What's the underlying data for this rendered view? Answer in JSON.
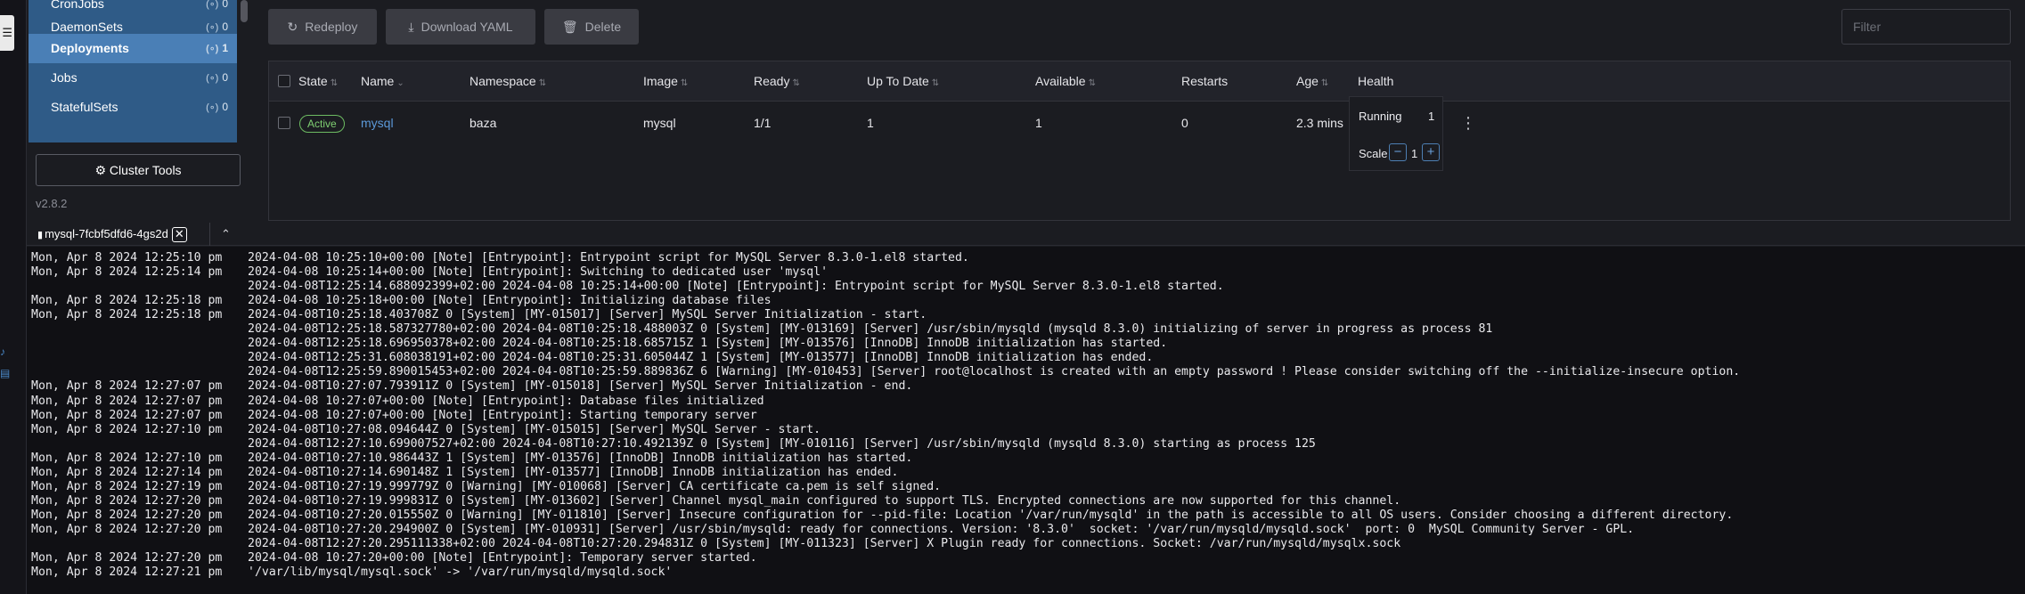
{
  "sidebar": {
    "items": [
      {
        "label": "CronJobs",
        "count": "0",
        "active": false
      },
      {
        "label": "DaemonSets",
        "count": "0",
        "active": false
      },
      {
        "label": "Deployments",
        "count": "1",
        "active": true
      },
      {
        "label": "Jobs",
        "count": "0",
        "active": false
      },
      {
        "label": "StatefulSets",
        "count": "0",
        "active": false
      }
    ],
    "namespace_icon": "(∘)",
    "cluster_tools_label": "Cluster Tools",
    "version": "v2.8.2"
  },
  "toolbar": {
    "redeploy_label": "Redeploy",
    "download_label": "Download YAML",
    "delete_label": "Delete",
    "filter_placeholder": "Filter"
  },
  "table": {
    "headers": {
      "state": "State",
      "name": "Name",
      "namespace": "Namespace",
      "image": "Image",
      "ready": "Ready",
      "uptodate": "Up To Date",
      "available": "Available",
      "restarts": "Restarts",
      "age": "Age",
      "health": "Health"
    },
    "row": {
      "state": "Active",
      "name": "mysql",
      "namespace": "baza",
      "image": "mysql",
      "ready": "1/1",
      "uptodate": "1",
      "available": "1",
      "restarts": "0",
      "age": "2.3 mins"
    },
    "health_popup": {
      "running_label": "Running",
      "running_value": "1",
      "scale_label": "Scale",
      "scale_value": "1",
      "minus": "−",
      "plus": "+"
    },
    "colors": {
      "active": "#7fcf72",
      "link": "#5b98d8",
      "health": "#4f8c55"
    }
  },
  "log": {
    "tab_title": "mysql-7fcbf5dfd6-4gs2d",
    "lines": [
      {
        "ts": "Mon, Apr 8 2024 12:25:10 pm",
        "msg": "2024-04-08 10:25:10+00:00 [Note] [Entrypoint]: Entrypoint script for MySQL Server 8.3.0-1.el8 started."
      },
      {
        "ts": "Mon, Apr 8 2024 12:25:14 pm",
        "msg": "2024-04-08 10:25:14+00:00 [Note] [Entrypoint]: Switching to dedicated user 'mysql'"
      },
      {
        "ts": "",
        "msg": "2024-04-08T12:25:14.688092399+02:00 2024-04-08 10:25:14+00:00 [Note] [Entrypoint]: Entrypoint script for MySQL Server 8.3.0-1.el8 started."
      },
      {
        "ts": "Mon, Apr 8 2024 12:25:18 pm",
        "msg": "2024-04-08 10:25:18+00:00 [Note] [Entrypoint]: Initializing database files"
      },
      {
        "ts": "Mon, Apr 8 2024 12:25:18 pm",
        "msg": "2024-04-08T10:25:18.403708Z 0 [System] [MY-015017] [Server] MySQL Server Initialization - start."
      },
      {
        "ts": "",
        "msg": "2024-04-08T12:25:18.587327780+02:00 2024-04-08T10:25:18.488003Z 0 [System] [MY-013169] [Server] /usr/sbin/mysqld (mysqld 8.3.0) initializing of server in progress as process 81"
      },
      {
        "ts": "",
        "msg": "2024-04-08T12:25:18.696950378+02:00 2024-04-08T10:25:18.685715Z 1 [System] [MY-013576] [InnoDB] InnoDB initialization has started."
      },
      {
        "ts": "",
        "msg": "2024-04-08T12:25:31.608038191+02:00 2024-04-08T10:25:31.605044Z 1 [System] [MY-013577] [InnoDB] InnoDB initialization has ended."
      },
      {
        "ts": "",
        "msg": "2024-04-08T12:25:59.890015453+02:00 2024-04-08T10:25:59.889836Z 6 [Warning] [MY-010453] [Server] root@localhost is created with an empty password ! Please consider switching off the --initialize-insecure option."
      },
      {
        "ts": "Mon, Apr 8 2024 12:27:07 pm",
        "msg": "2024-04-08T10:27:07.793911Z 0 [System] [MY-015018] [Server] MySQL Server Initialization - end."
      },
      {
        "ts": "Mon, Apr 8 2024 12:27:07 pm",
        "msg": "2024-04-08 10:27:07+00:00 [Note] [Entrypoint]: Database files initialized"
      },
      {
        "ts": "Mon, Apr 8 2024 12:27:07 pm",
        "msg": "2024-04-08 10:27:07+00:00 [Note] [Entrypoint]: Starting temporary server"
      },
      {
        "ts": "Mon, Apr 8 2024 12:27:10 pm",
        "msg": "2024-04-08T10:27:08.094644Z 0 [System] [MY-015015] [Server] MySQL Server - start."
      },
      {
        "ts": "",
        "msg": "2024-04-08T12:27:10.699007527+02:00 2024-04-08T10:27:10.492139Z 0 [System] [MY-010116] [Server] /usr/sbin/mysqld (mysqld 8.3.0) starting as process 125"
      },
      {
        "ts": "Mon, Apr 8 2024 12:27:10 pm",
        "msg": "2024-04-08T10:27:10.986443Z 1 [System] [MY-013576] [InnoDB] InnoDB initialization has started."
      },
      {
        "ts": "Mon, Apr 8 2024 12:27:14 pm",
        "msg": "2024-04-08T10:27:14.690148Z 1 [System] [MY-013577] [InnoDB] InnoDB initialization has ended."
      },
      {
        "ts": "Mon, Apr 8 2024 12:27:19 pm",
        "msg": "2024-04-08T10:27:19.999779Z 0 [Warning] [MY-010068] [Server] CA certificate ca.pem is self signed."
      },
      {
        "ts": "Mon, Apr 8 2024 12:27:20 pm",
        "msg": "2024-04-08T10:27:19.999831Z 0 [System] [MY-013602] [Server] Channel mysql_main configured to support TLS. Encrypted connections are now supported for this channel."
      },
      {
        "ts": "Mon, Apr 8 2024 12:27:20 pm",
        "msg": "2024-04-08T10:27:20.015550Z 0 [Warning] [MY-011810] [Server] Insecure configuration for --pid-file: Location '/var/run/mysqld' in the path is accessible to all OS users. Consider choosing a different directory."
      },
      {
        "ts": "Mon, Apr 8 2024 12:27:20 pm",
        "msg": "2024-04-08T10:27:20.294900Z 0 [System] [MY-010931] [Server] /usr/sbin/mysqld: ready for connections. Version: '8.3.0'  socket: '/var/run/mysqld/mysqld.sock'  port: 0  MySQL Community Server - GPL."
      },
      {
        "ts": "",
        "msg": "2024-04-08T12:27:20.295111338+02:00 2024-04-08T10:27:20.294831Z 0 [System] [MY-011323] [Server] X Plugin ready for connections. Socket: /var/run/mysqld/mysqlx.sock"
      },
      {
        "ts": "Mon, Apr 8 2024 12:27:20 pm",
        "msg": "2024-04-08 10:27:20+00:00 [Note] [Entrypoint]: Temporary server started."
      },
      {
        "ts": "Mon, Apr 8 2024 12:27:21 pm",
        "msg": "'/var/lib/mysql/mysql.sock' -> '/var/run/mysqld/mysqld.sock'"
      }
    ]
  }
}
